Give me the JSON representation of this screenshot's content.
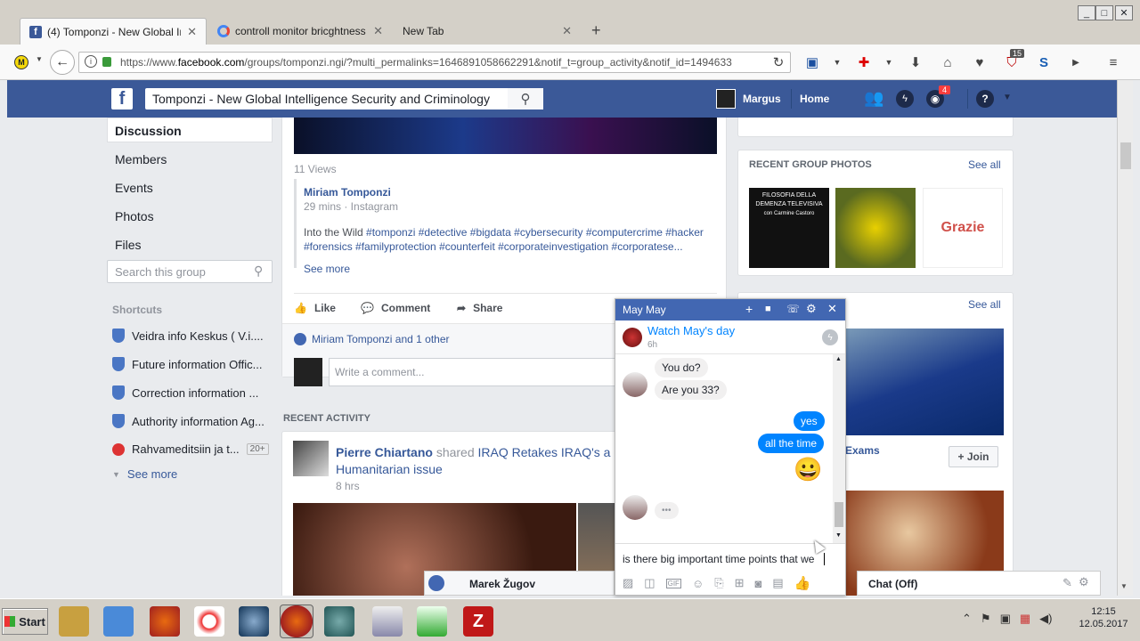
{
  "browser": {
    "tabs": [
      {
        "label": "(4) Tomponzi - New Global In"
      },
      {
        "label": "controll monitor bricghtness"
      },
      {
        "label": "New Tab"
      }
    ],
    "new_tab": "+",
    "url_prefix": "https://www.",
    "url_domain": "facebook.com",
    "url_rest": "/groups/tomponzi.ngi/?multi_permalinks=1646891058662291&notif_t=group_activity&notif_id=1494633",
    "badge_count": "15",
    "win_min": "_",
    "win_max": "□",
    "win_close": "✕"
  },
  "fb_header": {
    "logo": "f",
    "search_value": "Tomponzi - New Global Intelligence Security and Criminology",
    "user_name": "Margus",
    "home": "Home",
    "notif_count": "4",
    "help": "?"
  },
  "left_nav": {
    "items": [
      "Discussion",
      "Members",
      "Events",
      "Photos",
      "Files"
    ],
    "search_placeholder": "Search this group",
    "shortcuts_title": "Shortcuts",
    "shortcuts": [
      "Veidra info Keskus ( V.i....",
      "Future information Offic...",
      "Correction information ...",
      "Authority information Ag...",
      "Rahvameditsiin ja t..."
    ],
    "shortcut_badge": "20+",
    "see_more": "See more"
  },
  "post": {
    "views": "11 Views",
    "author": "Miriam Tomponzi",
    "time": "29 mins · Instagram",
    "text_plain": "Into the Wild ",
    "hashtags_line1": "#tomponzi #detective #bigdata #cybersecurity #computercrime #hacker",
    "hashtags_line2": "#forensics #familyprotection #counterfeit #corporateinvestigation #corporatese...",
    "see_more": "See more",
    "like": "Like",
    "comment": "Comment",
    "share": "Share",
    "likes_text": "Miriam Tomponzi and 1 other",
    "comment_placeholder": "Write a comment..."
  },
  "recent_activity": {
    "title": "RECENT ACTIVITY",
    "author": "Pierre Chiartano",
    "action": " shared ",
    "target": "IRAQ Retakes IRAQ's a",
    "line2": "Humanitarian issue",
    "time": "8 hrs"
  },
  "right_col": {
    "photos_title": "RECENT GROUP PHOTOS",
    "see_all": "See all",
    "photo1_lines": [
      "FILOSOFIA DELLA",
      "DEMENZA TELEVISIVA",
      "con Carmine Castoro"
    ],
    "photo3_word": "Grazie",
    "see_all_2": "See all",
    "exams": "Exams",
    "join": "+ Join"
  },
  "chat": {
    "name": "May May",
    "watch_link": "Watch May's day",
    "watch_time": "6h",
    "msgs_in_1": [
      "You do?",
      "Are you 33?"
    ],
    "msgs_out": [
      "yes",
      "all the time"
    ],
    "emoji": "😀",
    "typing": "•••",
    "input_value": "is there big important time points that we",
    "footer_names": "Marek Žugov",
    "chat_status": "Chat (Off)"
  },
  "taskbar": {
    "start": "Start",
    "time": "12:15",
    "date": "12.05.2017"
  },
  "colors": {
    "fb_blue": "#3b5998",
    "messenger_blue": "#0084ff",
    "link": "#365899"
  }
}
